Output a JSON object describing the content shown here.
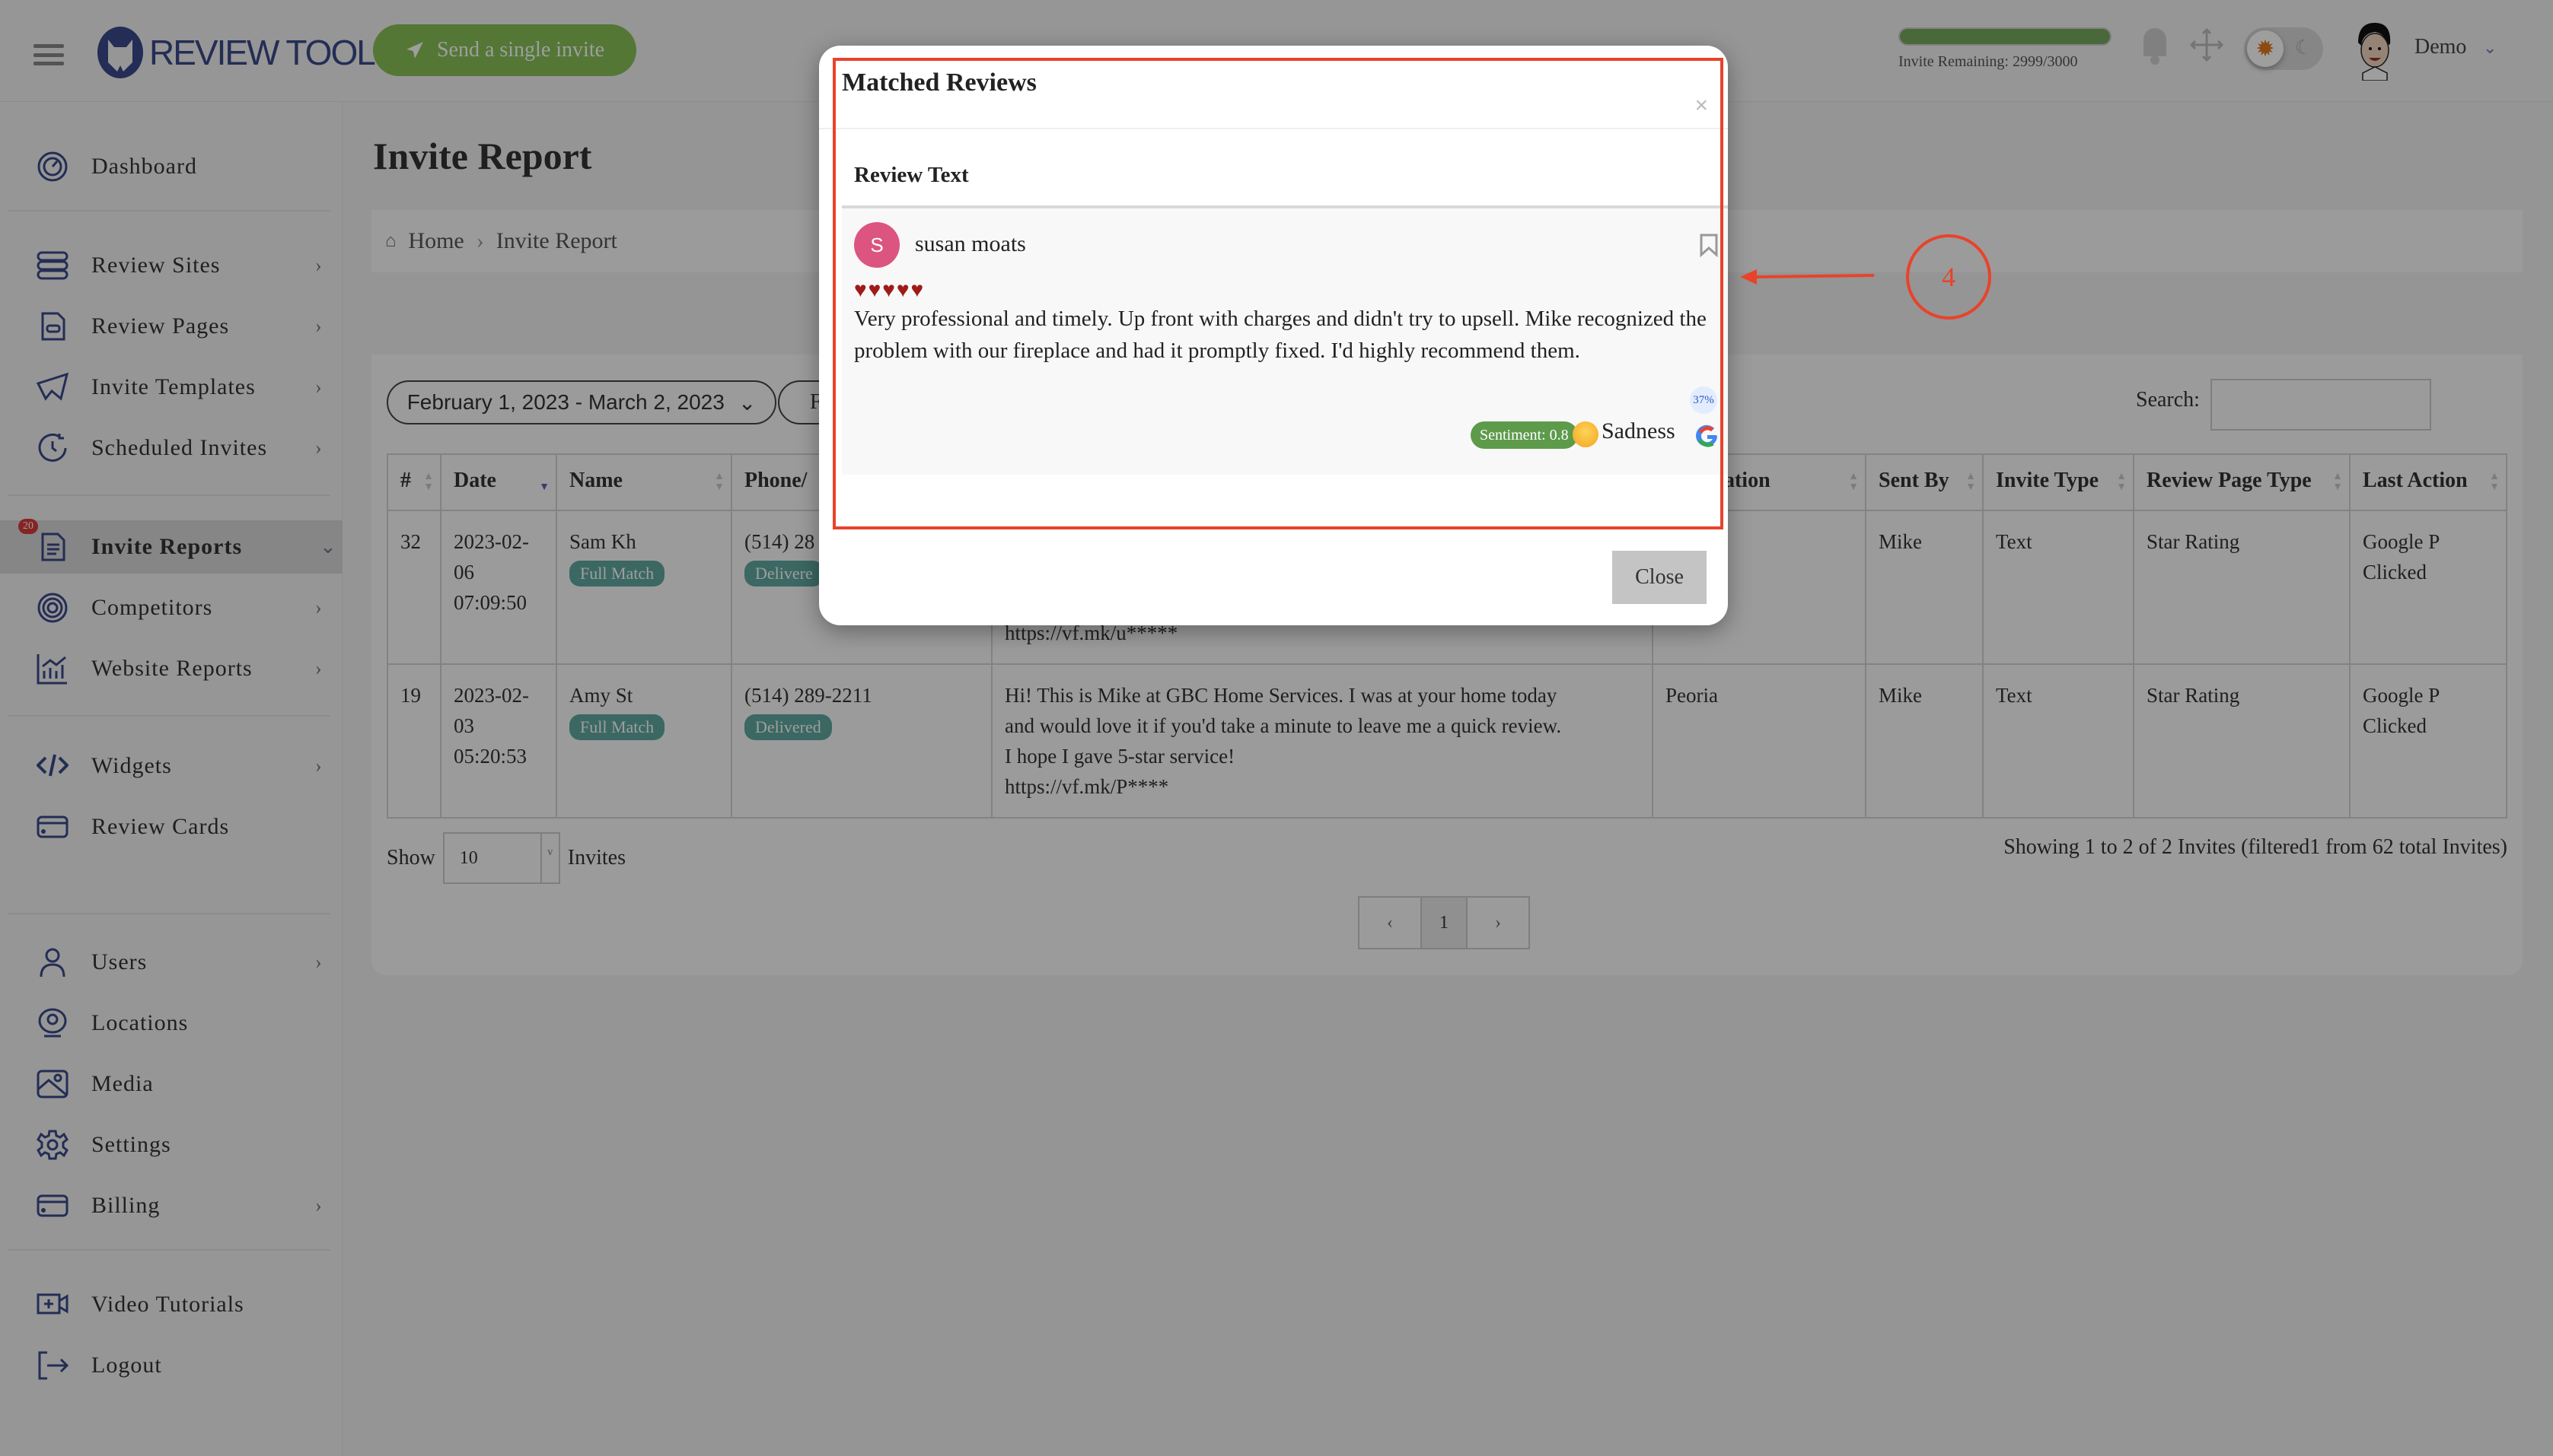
{
  "header": {
    "logo_text": "REVIEW TOOL",
    "send_invite_label": "Send a single invite",
    "invite_remaining_label": "Invite Remaining:",
    "invite_remaining_value": "2999/3000",
    "invite_remaining_fraction": 0.9997,
    "user_name": "Demo"
  },
  "sidebar": {
    "items": [
      {
        "label": "Dashboard",
        "icon": "dashboard-icon",
        "chevron": false
      },
      {
        "label": "Review Sites",
        "icon": "database-icon",
        "chevron": true
      },
      {
        "label": "Review Pages",
        "icon": "file-icon",
        "chevron": true
      },
      {
        "label": "Invite Templates",
        "icon": "send-icon",
        "chevron": true
      },
      {
        "label": "Scheduled Invites",
        "icon": "clock-refresh-icon",
        "chevron": true
      },
      {
        "label": "Invite Reports",
        "icon": "report-icon",
        "chevron": true,
        "active": true,
        "badge": "20"
      },
      {
        "label": "Competitors",
        "icon": "target-icon",
        "chevron": true
      },
      {
        "label": "Website Reports",
        "icon": "chart-icon",
        "chevron": true
      },
      {
        "label": "Widgets",
        "icon": "code-icon",
        "chevron": true
      },
      {
        "label": "Review Cards",
        "icon": "card-icon",
        "chevron": false
      },
      {
        "label": "Users",
        "icon": "user-icon",
        "chevron": true
      },
      {
        "label": "Locations",
        "icon": "location-icon",
        "chevron": false
      },
      {
        "label": "Media",
        "icon": "image-icon",
        "chevron": false
      },
      {
        "label": "Settings",
        "icon": "gear-icon",
        "chevron": false
      },
      {
        "label": "Billing",
        "icon": "card-icon",
        "chevron": true
      },
      {
        "label": "Video Tutorials",
        "icon": "video-icon",
        "chevron": false
      },
      {
        "label": "Logout",
        "icon": "logout-icon",
        "chevron": false
      }
    ]
  },
  "main": {
    "page_title": "Invite Report",
    "breadcrumb": [
      "Home",
      "Invite Report"
    ],
    "date_range": "February 1, 2023 - March 2, 2023",
    "second_filter_partial": "F",
    "search_label": "Search:",
    "search_value": "",
    "table": {
      "columns": [
        "#",
        "Date",
        "Name",
        "Phone/",
        "ce Location",
        "Sent By",
        "Invite Type",
        "Review Page Type",
        "Last Action"
      ],
      "rows": [
        {
          "id": "32",
          "date": [
            "2023-02-",
            "06",
            "07:09:50"
          ],
          "name": "Sam Kh",
          "name_badge": "Full Match",
          "phone": "(514) 28",
          "phone_badge": "Delivere",
          "message_tail": "https://vf.mk/u*****",
          "location": "",
          "sent_by": "Mike",
          "invite_type": "Text",
          "review_page_type": "Star Rating",
          "last_action": [
            "Google P",
            "Clicked"
          ]
        },
        {
          "id": "19",
          "date": [
            "2023-02-",
            "03",
            "05:20:53"
          ],
          "name": "Amy St",
          "name_badge": "Full Match",
          "phone": "(514) 289-2211",
          "phone_badge": "Delivered",
          "message": [
            "Hi! This is Mike at GBC Home Services. I was at your home today",
            "and would love it if you'd take a minute to leave me a quick review.",
            "I hope I gave 5-star service!",
            "https://vf.mk/P****"
          ],
          "location": "Peoria",
          "sent_by": "Mike",
          "invite_type": "Text",
          "review_page_type": "Star Rating",
          "last_action": [
            "Google P",
            "Clicked"
          ]
        }
      ]
    },
    "show_label": "Show",
    "show_value": "10",
    "show_suffix": "Invites",
    "showing_text": "Showing 1 to 2 of 2 Invites (filtered1 from 62 total Invites)",
    "pager": {
      "prev": "‹",
      "current": "1",
      "next": "›"
    }
  },
  "modal": {
    "title": "Matched Reviews",
    "close_x": "×",
    "column_label": "Review Text",
    "review": {
      "avatar_letter": "S",
      "author": "susan moats",
      "rating": 5,
      "hearts": "♥♥♥♥♥",
      "text": "Very professional and timely. Up front with charges and didn't try to upsell. Mike recognized the problem with our fireplace and had it promptly fixed. I'd highly recommend them.",
      "sentiment_label": "Sentiment: 0.8",
      "emotion": "Sadness",
      "emotion_percent": "37%",
      "source": "google"
    },
    "close_label": "Close"
  },
  "annotation": {
    "step_number": "4",
    "color": "#e8432a"
  }
}
